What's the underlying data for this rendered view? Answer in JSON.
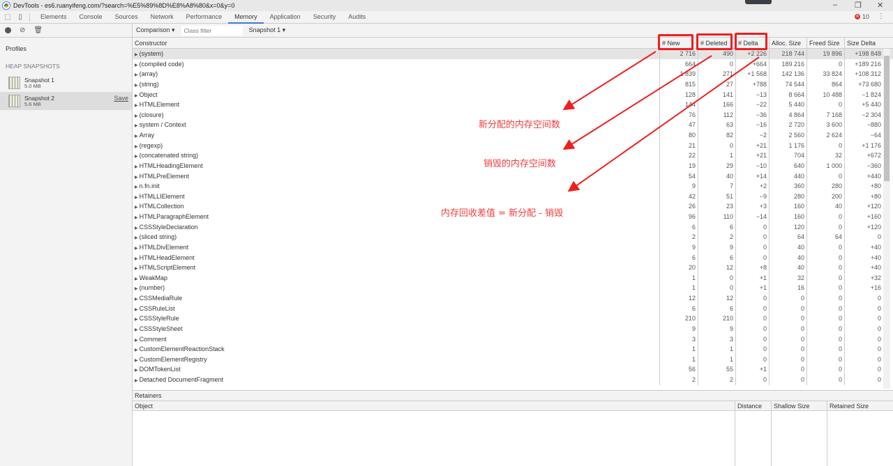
{
  "window": {
    "title": "DevTools - es6.ruanyifeng.com/?search=%E5%89%8D%E8%A8%80&x=0&y=0"
  },
  "tabs": [
    {
      "label": "Elements"
    },
    {
      "label": "Console"
    },
    {
      "label": "Sources"
    },
    {
      "label": "Network"
    },
    {
      "label": "Performance"
    },
    {
      "label": "Memory",
      "active": true
    },
    {
      "label": "Application"
    },
    {
      "label": "Security"
    },
    {
      "label": "Audits"
    }
  ],
  "error_count": "10",
  "sidebar": {
    "profiles_label": "Profiles",
    "section": "HEAP SNAPSHOTS",
    "snapshots": [
      {
        "name": "Snapshot 1",
        "size": "5.0 MB"
      },
      {
        "name": "Snapshot 2",
        "size": "5.6 MB",
        "save": "Save",
        "selected": true
      }
    ]
  },
  "toolbar": {
    "view": "Comparison",
    "filter_placeholder": "Class filter",
    "base": "Snapshot 1"
  },
  "table": {
    "headers": [
      "Constructor",
      "# New",
      "# Deleted",
      "# Delta",
      "Alloc. Size",
      "Freed Size",
      "Size Delta"
    ],
    "rows": [
      [
        "(system)",
        "2 716",
        "490",
        "+2 226",
        "218 744",
        "19 896",
        "+198 848"
      ],
      [
        "(compiled code)",
        "664",
        "0",
        "+664",
        "189 216",
        "0",
        "+189 216"
      ],
      [
        "(array)",
        "1 839",
        "271",
        "+1 568",
        "142 136",
        "33 824",
        "+108 312"
      ],
      [
        "(string)",
        "815",
        "27",
        "+788",
        "74 544",
        "864",
        "+73 680"
      ],
      [
        "Object",
        "128",
        "141",
        "−13",
        "8 664",
        "10 488",
        "−1 824"
      ],
      [
        "HTMLElement",
        "144",
        "166",
        "−22",
        "5 440",
        "0",
        "+5 440"
      ],
      [
        "(closure)",
        "76",
        "112",
        "−36",
        "4 864",
        "7 168",
        "−2 304"
      ],
      [
        "system / Context",
        "47",
        "63",
        "−16",
        "2 720",
        "3 600",
        "−880"
      ],
      [
        "Array",
        "80",
        "82",
        "−2",
        "2 560",
        "2 624",
        "−64"
      ],
      [
        "(regexp)",
        "21",
        "0",
        "+21",
        "1 176",
        "0",
        "+1 176"
      ],
      [
        "(concatenated string)",
        "22",
        "1",
        "+21",
        "704",
        "32",
        "+672"
      ],
      [
        "HTMLHeadingElement",
        "19",
        "29",
        "−10",
        "640",
        "1 000",
        "−360"
      ],
      [
        "HTMLPreElement",
        "54",
        "40",
        "+14",
        "440",
        "0",
        "+440"
      ],
      [
        "n.fn.init",
        "9",
        "7",
        "+2",
        "360",
        "280",
        "+80"
      ],
      [
        "HTMLLIElement",
        "42",
        "51",
        "−9",
        "280",
        "200",
        "+80"
      ],
      [
        "HTMLCollection",
        "26",
        "23",
        "+3",
        "160",
        "40",
        "+120"
      ],
      [
        "HTMLParagraphElement",
        "96",
        "110",
        "−14",
        "160",
        "0",
        "+160"
      ],
      [
        "CSSStyleDeclaration",
        "6",
        "6",
        "0",
        "120",
        "0",
        "+120"
      ],
      [
        "(sliced string)",
        "2",
        "2",
        "0",
        "64",
        "64",
        "0"
      ],
      [
        "HTMLDivElement",
        "9",
        "9",
        "0",
        "40",
        "0",
        "+40"
      ],
      [
        "HTMLHeadElement",
        "6",
        "6",
        "0",
        "40",
        "0",
        "+40"
      ],
      [
        "HTMLScriptElement",
        "20",
        "12",
        "+8",
        "40",
        "0",
        "+40"
      ],
      [
        "WeakMap",
        "1",
        "0",
        "+1",
        "32",
        "0",
        "+32"
      ],
      [
        "(number)",
        "1",
        "0",
        "+1",
        "16",
        "0",
        "+16"
      ],
      [
        "CSSMediaRule",
        "12",
        "12",
        "0",
        "0",
        "0",
        "0"
      ],
      [
        "CSSRuleList",
        "6",
        "6",
        "0",
        "0",
        "0",
        "0"
      ],
      [
        "CSSStyleRule",
        "210",
        "210",
        "0",
        "0",
        "0",
        "0"
      ],
      [
        "CSSStyleSheet",
        "9",
        "9",
        "0",
        "0",
        "0",
        "0"
      ],
      [
        "Comment",
        "3",
        "3",
        "0",
        "0",
        "0",
        "0"
      ],
      [
        "CustomElementReactionStack",
        "1",
        "1",
        "0",
        "0",
        "0",
        "0"
      ],
      [
        "CustomElementRegistry",
        "1",
        "1",
        "0",
        "0",
        "0",
        "0"
      ],
      [
        "DOMTokenList",
        "56",
        "55",
        "+1",
        "0",
        "0",
        "0"
      ],
      [
        "Detached DocumentFragment",
        "2",
        "2",
        "0",
        "0",
        "0",
        "0"
      ]
    ]
  },
  "retainers": {
    "title": "Retainers",
    "headers": [
      "Object",
      "Distance",
      "Shallow Size",
      "Retained Size"
    ]
  },
  "annotations": {
    "new_label": "新分配的内存空间数",
    "deleted_label": "销毁的内存空间数",
    "delta_label": "内存回收差值 = 新分配 - 销毁",
    "color": "#f01e1e"
  }
}
